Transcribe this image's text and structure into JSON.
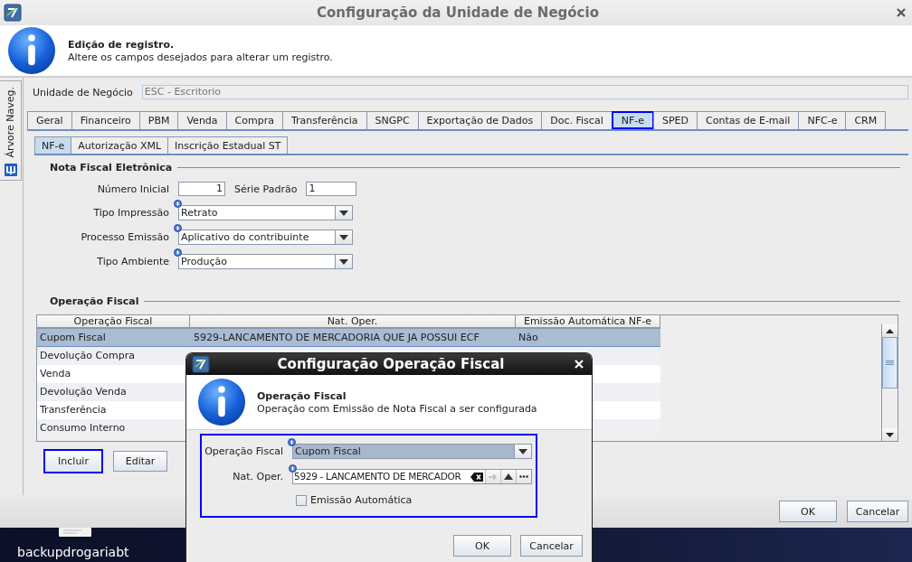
{
  "window": {
    "title": "Configuração da Unidade de Negócio"
  },
  "header": {
    "title": "Edição de registro.",
    "message": "Altere os campos desejados para alterar um registro."
  },
  "side_panel": {
    "label": "Árvore Naveg."
  },
  "business_unit": {
    "label": "Unidade de Negócio",
    "value": "ESC - Escritorio",
    "disabled": true
  },
  "tabs": [
    {
      "label": "Geral",
      "selected": false
    },
    {
      "label": "Financeiro",
      "selected": false
    },
    {
      "label": "PBM",
      "selected": false
    },
    {
      "label": "Venda",
      "selected": false
    },
    {
      "label": "Compra",
      "selected": false
    },
    {
      "label": "Transferência",
      "selected": false
    },
    {
      "label": "SNGPC",
      "selected": false
    },
    {
      "label": "Exportação de Dados",
      "selected": false
    },
    {
      "label": "Doc. Fiscal",
      "selected": false
    },
    {
      "label": "NF-e",
      "selected": true
    },
    {
      "label": "SPED",
      "selected": false
    },
    {
      "label": "Contas de E-mail",
      "selected": false
    },
    {
      "label": "NFC-e",
      "selected": false
    },
    {
      "label": "CRM",
      "selected": false
    }
  ],
  "subtabs": [
    {
      "label": "NF-e",
      "selected": true
    },
    {
      "label": "Autorização XML",
      "selected": false
    },
    {
      "label": "Inscrição Estadual ST",
      "selected": false
    }
  ],
  "nfe_section": {
    "title": "Nota Fiscal Eletrônica",
    "numero_inicial": {
      "label": "Número Inicial",
      "value": "1"
    },
    "serie_padrao": {
      "label": "Série Padrão",
      "value": "1"
    },
    "selects": [
      {
        "label": "Tipo Impressão",
        "value": "Retrato",
        "required": true
      },
      {
        "label": "Processo Emissão",
        "value": "Aplicativo do contribuinte",
        "required": true
      },
      {
        "label": "Tipo Ambiente",
        "value": "Produção",
        "required": true
      }
    ]
  },
  "operations": {
    "title": "Operação Fiscal",
    "columns": [
      "Operação Fiscal",
      "Nat. Oper.",
      "Emissão Automática NF-e"
    ],
    "rows": [
      {
        "cells": [
          "Cupom Fiscal",
          "5929-LANCAMENTO DE MERCADORIA QUE JA POSSUI ECF",
          "Não"
        ],
        "selected": true
      },
      {
        "cells": [
          "Devolução Compra"
        ],
        "selected": false
      },
      {
        "cells": [
          "Venda"
        ],
        "selected": false
      },
      {
        "cells": [
          "Devolução Venda"
        ],
        "selected": false
      },
      {
        "cells": [
          "Transferência"
        ],
        "selected": false
      },
      {
        "cells": [
          "Consumo Interno"
        ],
        "selected": false
      }
    ],
    "buttons": [
      {
        "label": "Incluir",
        "focused": true
      },
      {
        "label": "Editar",
        "focused": false
      }
    ]
  },
  "buttons": [
    {
      "label": "OK"
    },
    {
      "label": "Cancelar"
    }
  ],
  "dialog": {
    "title": "Configuração Operação Fiscal",
    "header": {
      "title": "Operação Fiscal",
      "message": "Operação com Emissão de Nota Fiscal a ser configurada"
    },
    "fields": [
      {
        "kind": "select",
        "label": "Operação Fiscal",
        "value": "Cupom Fiscal",
        "required": true
      },
      {
        "kind": "lookup",
        "label": "Nat. Oper.",
        "value": "5929 - LANCAMENTO DE MERCADOR",
        "required": true
      }
    ],
    "checkbox": {
      "label": "Emissão Automática",
      "checked": false
    },
    "buttons": [
      {
        "label": "OK"
      },
      {
        "label": "Cancelar"
      }
    ]
  },
  "taskbar": {
    "desktop_icon": {
      "label": "backupdrogariabt"
    }
  }
}
